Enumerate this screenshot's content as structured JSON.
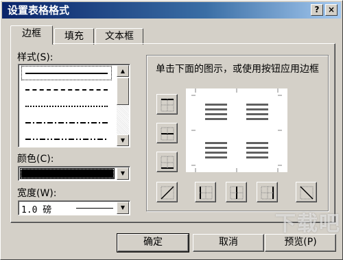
{
  "window": {
    "title": "设置表格格式",
    "help_glyph": "?",
    "close_glyph": "×"
  },
  "tabs": [
    {
      "label": "边框",
      "active": true
    },
    {
      "label": "填充",
      "active": false
    },
    {
      "label": "文本框",
      "active": false
    }
  ],
  "style": {
    "label": "样式(S):",
    "line_styles": [
      "solid",
      "dashed",
      "dotted",
      "dash-dot",
      "dash-dot-dot"
    ]
  },
  "color": {
    "label": "颜色(C):",
    "value": "#000000"
  },
  "width": {
    "label": "宽度(W):",
    "value": "1.0 磅"
  },
  "preview": {
    "hint": "单击下面的图示，或使用按钮应用边框"
  },
  "buttons": {
    "ok": "确定",
    "cancel": "取消",
    "preview": "预览(P)"
  },
  "icons": {
    "scroll_up": "▲",
    "scroll_down": "▼",
    "dropdown": "▼"
  },
  "watermark": "下载吧"
}
